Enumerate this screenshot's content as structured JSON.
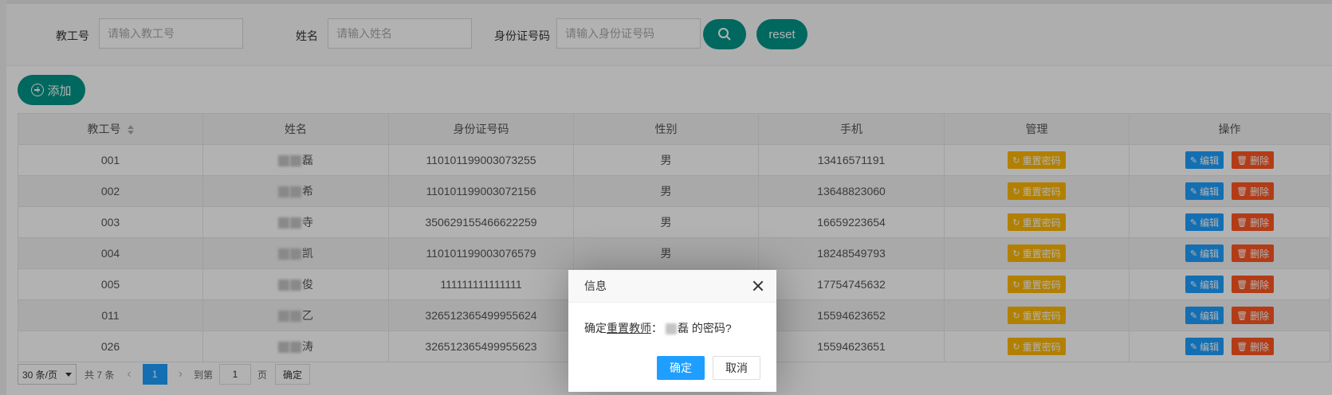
{
  "search": {
    "id_label": "教工号",
    "id_placeholder": "请输入教工号",
    "name_label": "姓名",
    "name_placeholder": "请输入姓名",
    "idcard_label": "身份证号码",
    "idcard_placeholder": "请输入身份证号码",
    "reset_label": "reset"
  },
  "toolbar": {
    "add_label": "添加"
  },
  "table": {
    "headers": [
      "教工号",
      "姓名",
      "身份证号码",
      "性别",
      "手机",
      "管理",
      "操作"
    ],
    "rows": [
      {
        "id": "001",
        "name": "磊",
        "idcard": "110101199003073255",
        "gender": "男",
        "phone": "13416571191"
      },
      {
        "id": "002",
        "name": "希",
        "idcard": "110101199003072156",
        "gender": "男",
        "phone": "13648823060"
      },
      {
        "id": "003",
        "name": "寺",
        "idcard": "350629155466622259",
        "gender": "男",
        "phone": "16659223654"
      },
      {
        "id": "004",
        "name": "凯",
        "idcard": "110101199003076579",
        "gender": "男",
        "phone": "18248549793"
      },
      {
        "id": "005",
        "name": "俊",
        "idcard": "111111111111111",
        "gender": "",
        "phone": "17754745632"
      },
      {
        "id": "011",
        "name": "乙",
        "idcard": "326512365499955624",
        "gender": "",
        "phone": "15594623652"
      },
      {
        "id": "026",
        "name": "涛",
        "idcard": "326512365499955623",
        "gender": "",
        "phone": "15594623651"
      }
    ],
    "reset_pwd_label": "重置密码",
    "edit_label": "编辑",
    "delete_label": "删除"
  },
  "pager": {
    "page_size": "30 条/页",
    "total": "共 7 条",
    "current_page": "1",
    "goto_label": "到第",
    "goto_value": "1",
    "page_unit": "页",
    "confirm_label": "确定"
  },
  "dialog": {
    "title": "信息",
    "msg_prefix": "确定",
    "msg_link": "重置教师",
    "msg_colon": "：",
    "msg_name": "磊",
    "msg_suffix": " 的密码?",
    "ok_label": "确定",
    "cancel_label": "取消"
  },
  "colors": {
    "primary": "#009688",
    "warn": "#ffb800",
    "blue": "#1e9fff",
    "danger": "#ff5722"
  }
}
